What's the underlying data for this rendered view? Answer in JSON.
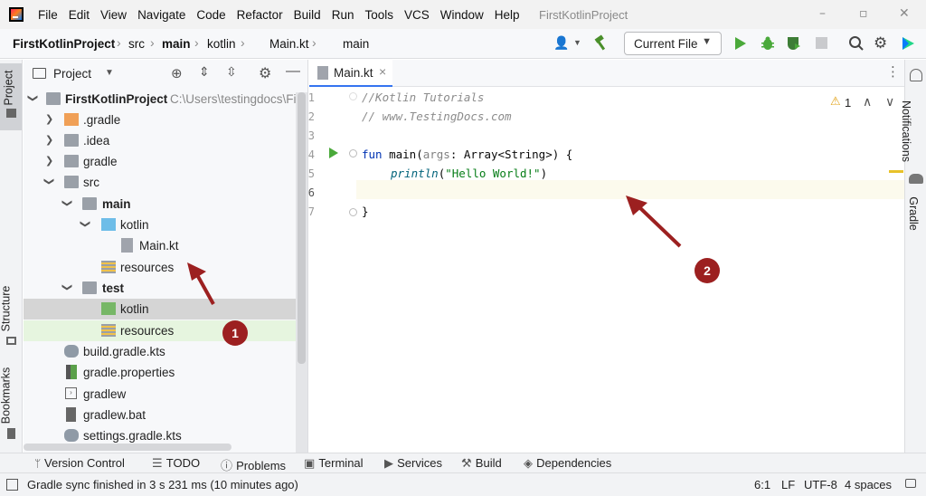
{
  "window": {
    "title": "FirstKotlinProject",
    "menu": [
      "File",
      "Edit",
      "View",
      "Navigate",
      "Code",
      "Refactor",
      "Build",
      "Run",
      "Tools",
      "VCS",
      "Window",
      "Help"
    ],
    "controls": {
      "minimize": "–",
      "maximize": "▫",
      "close": "✕"
    }
  },
  "breadcrumb": [
    "FirstKotlinProject",
    "src",
    "main",
    "kotlin",
    "Main.kt",
    "main"
  ],
  "toolbar": {
    "run_config": "Current File",
    "run_config_dropdown": "▼",
    "user_icon": "👤"
  },
  "project_panel": {
    "title": "Project",
    "dropdown": "▼",
    "root_path": "C:\\Users\\testingdocs\\FirstKotlinProject",
    "tree": [
      {
        "label": "FirstKotlinProject",
        "arrow": "❯",
        "bold": true
      },
      {
        "label": ".gradle",
        "arrow": "❯"
      },
      {
        "label": ".idea",
        "arrow": "❯"
      },
      {
        "label": "gradle",
        "arrow": "❯"
      },
      {
        "label": "src",
        "arrow": "❯"
      },
      {
        "label": "main",
        "arrow": "❯",
        "bold": true
      },
      {
        "label": "kotlin",
        "arrow": "❯"
      },
      {
        "label": "Main.kt",
        "arrow": ""
      },
      {
        "label": "resources",
        "arrow": ""
      },
      {
        "label": "test",
        "arrow": "❯",
        "bold": true
      },
      {
        "label": "kotlin",
        "arrow": ""
      },
      {
        "label": "resources",
        "arrow": ""
      },
      {
        "label": "build.gradle.kts",
        "arrow": ""
      },
      {
        "label": "gradle.properties",
        "arrow": ""
      },
      {
        "label": "gradlew",
        "arrow": ""
      },
      {
        "label": "gradlew.bat",
        "arrow": ""
      },
      {
        "label": "settings.gradle.kts",
        "arrow": ""
      }
    ]
  },
  "left_stripe": {
    "project": "Project",
    "structure": "Structure",
    "bookmarks": "Bookmarks"
  },
  "right_stripe": {
    "notifications": "Notifications",
    "gradle": "Gradle"
  },
  "editor": {
    "tab_label": "Main.kt",
    "tab_close": "×",
    "warnings": "1",
    "warning_icon": "⚠",
    "up": "∧",
    "down": "∨",
    "line_numbers": [
      "1",
      "2",
      "3",
      "4",
      "5",
      "6",
      "7"
    ],
    "lines": {
      "l1": "//Kotlin Tutorials",
      "l2": "// www.TestingDocs.com",
      "l4_kw": "fun",
      "l4_name": " main(",
      "l4_param": "args",
      "l4_rest": ": Array<String>) {",
      "l5_fn": "println",
      "l5_open": "(",
      "l5_str": "\"Hello World!\"",
      "l5_close": ")",
      "l7": "}"
    }
  },
  "annotations": {
    "one": "1",
    "two": "2"
  },
  "tool_windows": [
    "Version Control",
    "TODO",
    "Problems",
    "Terminal",
    "Services",
    "Build",
    "Dependencies"
  ],
  "status": {
    "message": "Gradle sync finished in 3 s 231 ms (10 minutes ago)",
    "position": "6:1",
    "line_sep": "LF",
    "encoding": "UTF-8",
    "indent": "4 spaces"
  },
  "colors": {
    "accent": "#3574f0",
    "selected_row": "#d5d5d5",
    "hover_row": "#e6f5df",
    "annotation": "#9c2020"
  }
}
